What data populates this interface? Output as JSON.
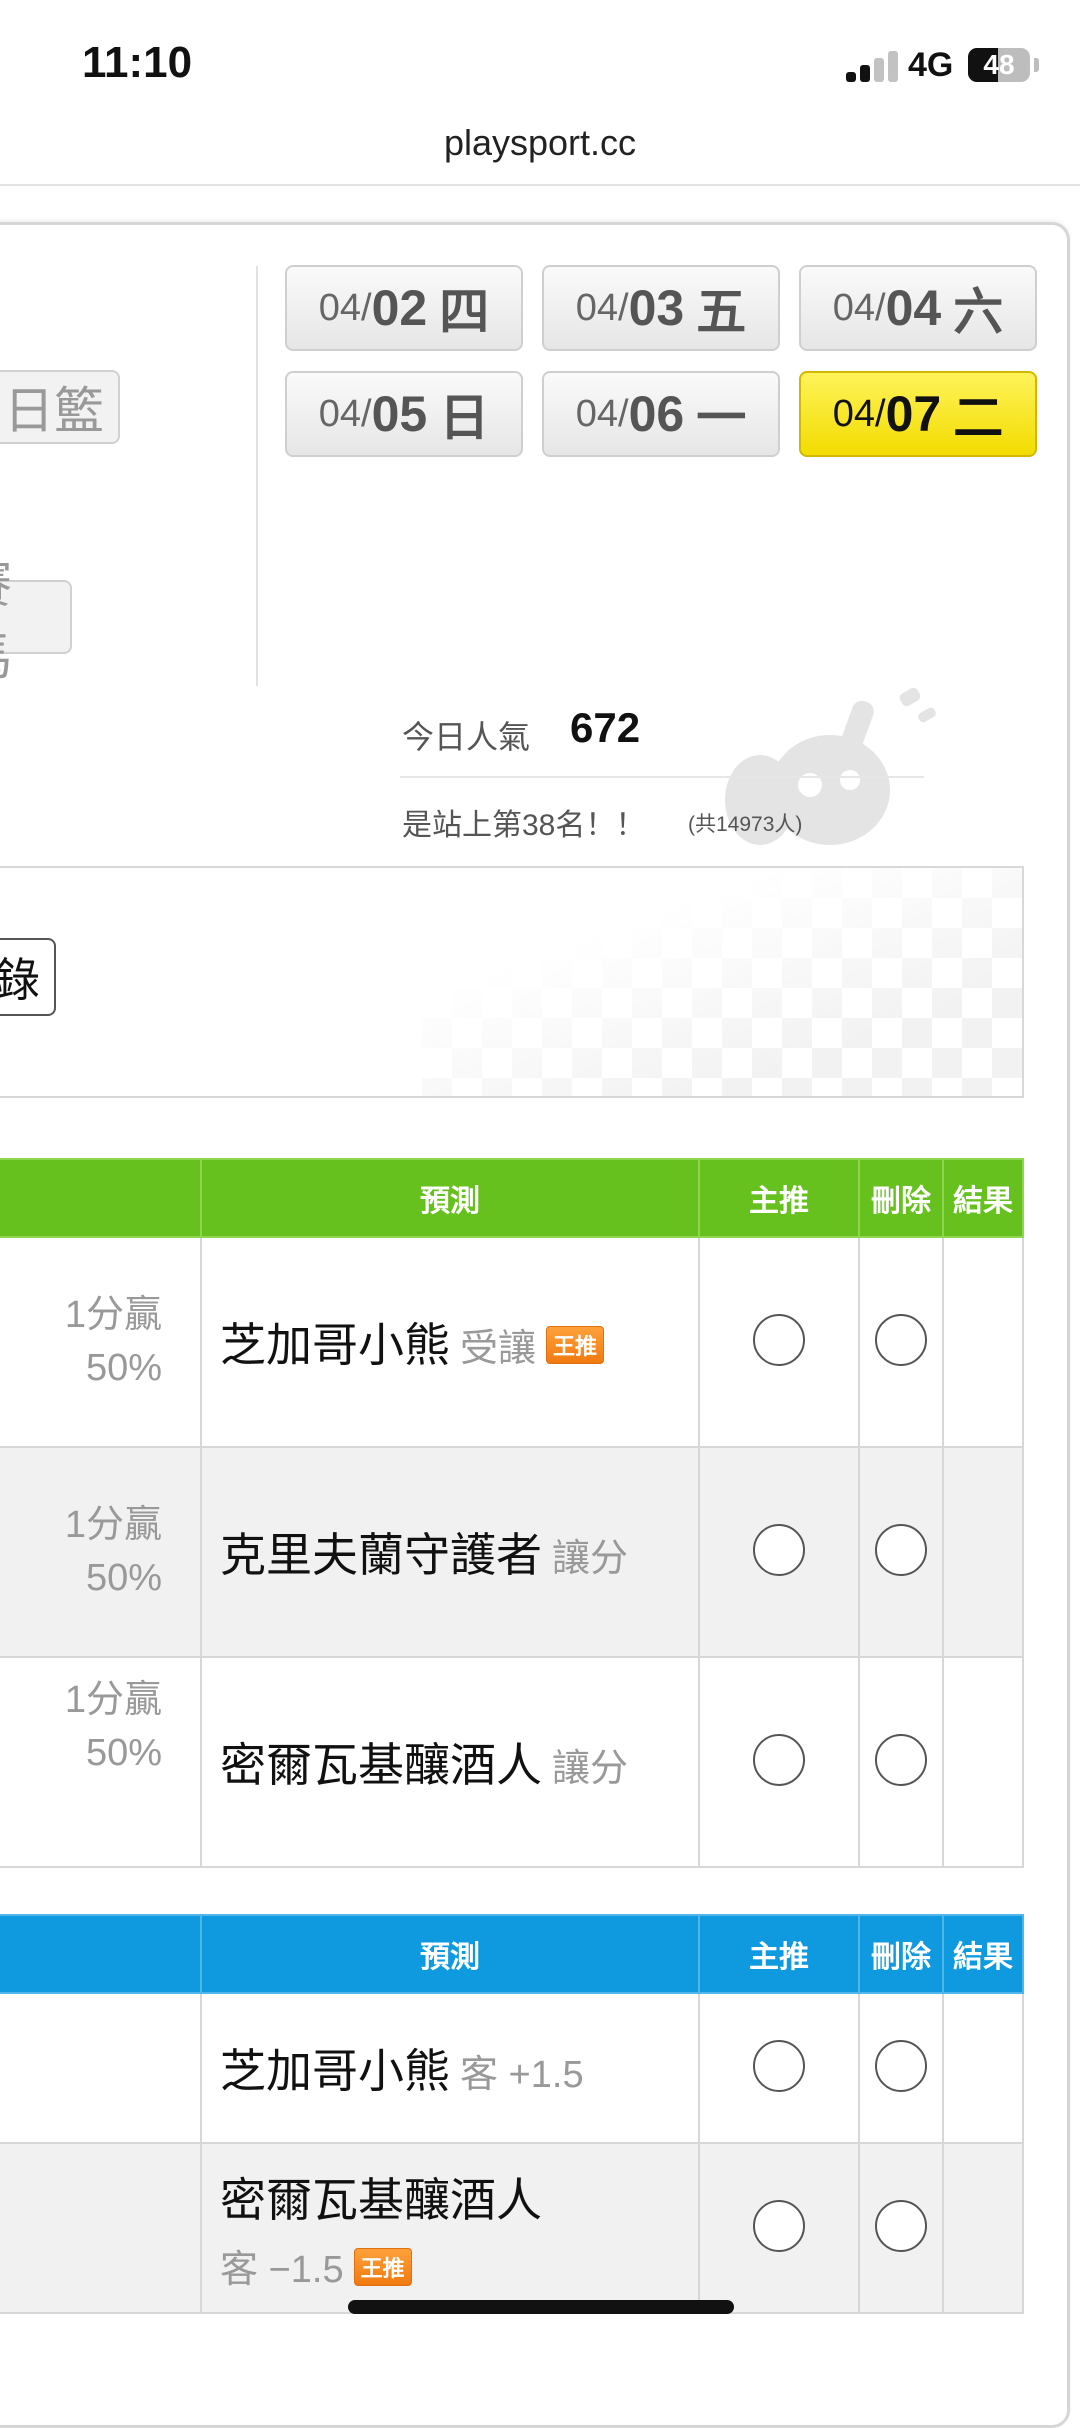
{
  "status_bar": {
    "time": "11:10",
    "network": "4G",
    "battery_level": "48"
  },
  "browser": {
    "url": "playsport.cc"
  },
  "sidebar_buttons": [
    "日籃",
    "賽馬"
  ],
  "dates": [
    {
      "mm": "04/",
      "dd": "02",
      "wd": "四",
      "active": false
    },
    {
      "mm": "04/",
      "dd": "03",
      "wd": "五",
      "active": false
    },
    {
      "mm": "04/",
      "dd": "04",
      "wd": "六",
      "active": false
    },
    {
      "mm": "04/",
      "dd": "05",
      "wd": "日",
      "active": false
    },
    {
      "mm": "04/",
      "dd": "06",
      "wd": "一",
      "active": false
    },
    {
      "mm": "04/",
      "dd": "07",
      "wd": "二",
      "active": true
    }
  ],
  "popularity": {
    "label": "今日人氣",
    "value": "672",
    "rank_text": "是站上第38名！！",
    "rank_total": "(共14973人)"
  },
  "record_button": "錄",
  "table1": {
    "headers": {
      "predict": "預測",
      "main": "主推",
      "delete": "刪除",
      "result": "結果"
    },
    "rows": [
      {
        "odds": "1分贏",
        "pct": "50%",
        "team": "芝加哥小熊",
        "side": "受讓",
        "tag": "王推"
      },
      {
        "odds": "1分贏",
        "pct": "50%",
        "team": "克里夫蘭守護者",
        "side": "讓分",
        "tag": ""
      },
      {
        "odds": "1分贏",
        "pct": "50%",
        "team": "密爾瓦基釀酒人",
        "side": "讓分",
        "tag": ""
      }
    ]
  },
  "table2": {
    "headers": {
      "predict": "預測",
      "main": "主推",
      "delete": "刪除",
      "result": "結果"
    },
    "rows": [
      {
        "team": "芝加哥小熊",
        "side": "客 +1.5",
        "tag": ""
      },
      {
        "team": "密爾瓦基釀酒人",
        "side": "客 −1.5",
        "tag": "王推"
      }
    ]
  }
}
